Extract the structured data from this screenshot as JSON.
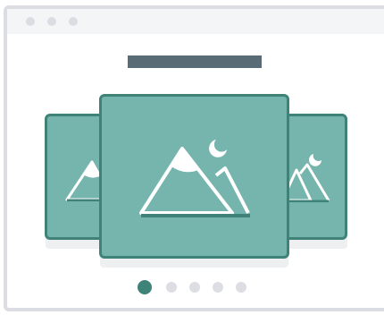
{
  "window": {
    "controls": [
      "close",
      "minimize",
      "maximize"
    ]
  },
  "carousel": {
    "title_placeholder": "",
    "slides": [
      {
        "position": "left",
        "icon": "image-placeholder-icon"
      },
      {
        "position": "center",
        "icon": "image-placeholder-icon"
      },
      {
        "position": "right",
        "icon": "image-placeholder-icon"
      }
    ],
    "pagination": {
      "count": 5,
      "active_index": 0
    }
  },
  "colors": {
    "slide_fill": "#76b5ad",
    "slide_border": "#3e8278",
    "title_bar": "#596b74",
    "chrome": "#dcdde3",
    "dot_inactive": "#dddee3",
    "dot_active": "#3e8278"
  }
}
